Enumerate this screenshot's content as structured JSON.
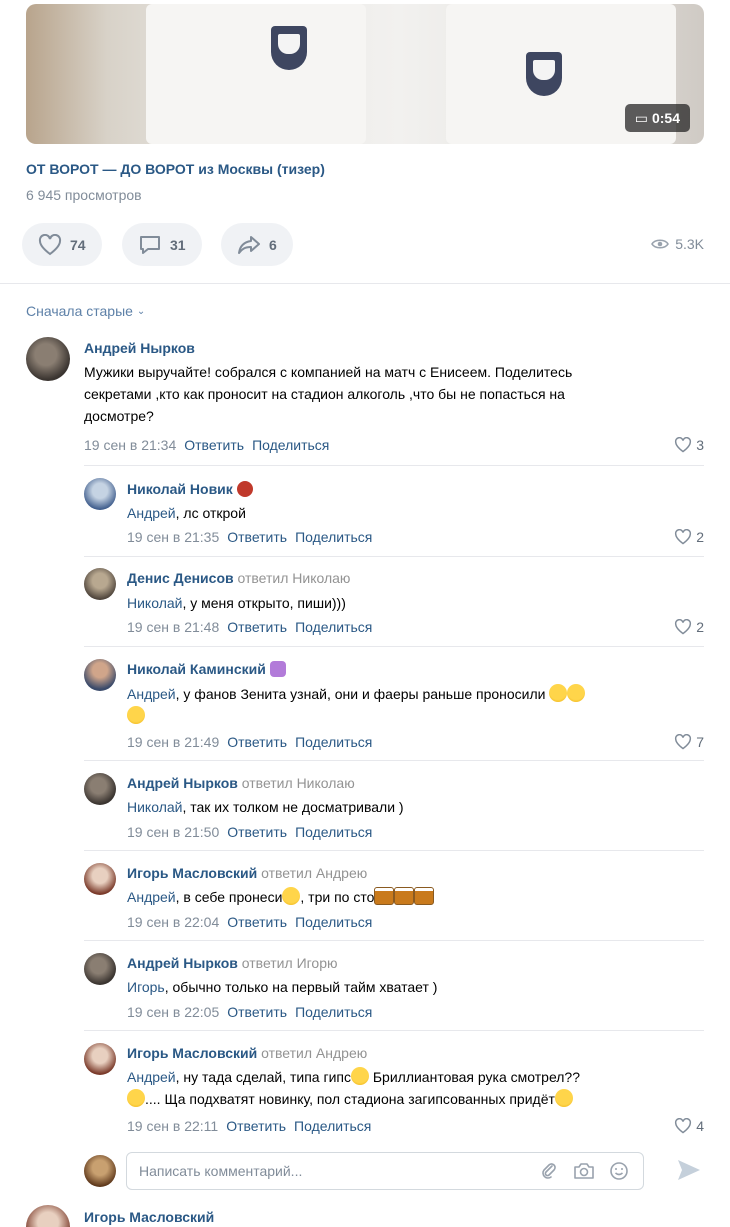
{
  "video": {
    "duration": "0:54",
    "title": "ОТ ВОРОТ — ДО ВОРОТ из Москвы (тизер)",
    "views": "6 945 просмотров"
  },
  "actions": {
    "likes": "74",
    "comments": "31",
    "shares": "6",
    "total_views": "5.3K"
  },
  "sort_label": "Сначала старые",
  "comments": [
    {
      "author": "Андрей Нырков",
      "reply_to": "",
      "mention": "",
      "text_lines": [
        "Мужики выручайте! собрался с компанией на матч с Енисеем. Поделитесь",
        "секретами ,кто как проносит на стадион алкоголь ,что бы не попасться на",
        "досмотре?"
      ],
      "date": "19 сен в 21:34",
      "reply_label": "Ответить",
      "share_label": "Поделиться",
      "likes": "3"
    },
    {
      "author": "Николай Новик",
      "reply_to": "",
      "mention": "Андрей",
      "text": ", лс открой",
      "date": "19 сен в 21:35",
      "reply_label": "Ответить",
      "share_label": "Поделиться",
      "likes": "2"
    },
    {
      "author": "Денис Денисов",
      "reply_to": "ответил Николаю",
      "mention": "Николай",
      "text": ", у меня открыто, пиши)))",
      "date": "19 сен в 21:48",
      "reply_label": "Ответить",
      "share_label": "Поделиться",
      "likes": "2"
    },
    {
      "author": "Николай Каминский",
      "reply_to": "",
      "mention": "Андрей",
      "text": ", у фанов Зенита узнай, они и фаеры раньше проносили",
      "date": "19 сен в 21:49",
      "reply_label": "Ответить",
      "share_label": "Поделиться",
      "likes": "7"
    },
    {
      "author": "Андрей Нырков",
      "reply_to": "ответил Николаю",
      "mention": "Николай",
      "text": ", так их толком не досматривали )",
      "date": "19 сен в 21:50",
      "reply_label": "Ответить",
      "share_label": "Поделиться",
      "likes": ""
    },
    {
      "author": "Игорь Масловский",
      "reply_to": "ответил Андрею",
      "mention": "Андрей",
      "text": ", в себе пронеси",
      "text_after": ", три по сто",
      "date": "19 сен в 22:04",
      "reply_label": "Ответить",
      "share_label": "Поделиться",
      "likes": ""
    },
    {
      "author": "Андрей Нырков",
      "reply_to": "ответил Игорю",
      "mention": "Игорь",
      "text": ", обычно только на первый тайм хватает )",
      "date": "19 сен в 22:05",
      "reply_label": "Ответить",
      "share_label": "Поделиться",
      "likes": ""
    },
    {
      "author": "Игорь Масловский",
      "reply_to": "ответил Андрею",
      "mention": "Андрей",
      "text": ", ну тада сделай, типа гипс",
      "text_after": " Бриллиантовая рука смотрел??",
      "text_line2": ".... Ща подхватят новинку, пол стадиона загипсованных придёт",
      "date": "19 сен в 22:11",
      "reply_label": "Ответить",
      "share_label": "Поделиться",
      "likes": "4"
    }
  ],
  "compose": {
    "placeholder": "Написать комментарий..."
  },
  "next_comment_author": "Игорь Масловский"
}
